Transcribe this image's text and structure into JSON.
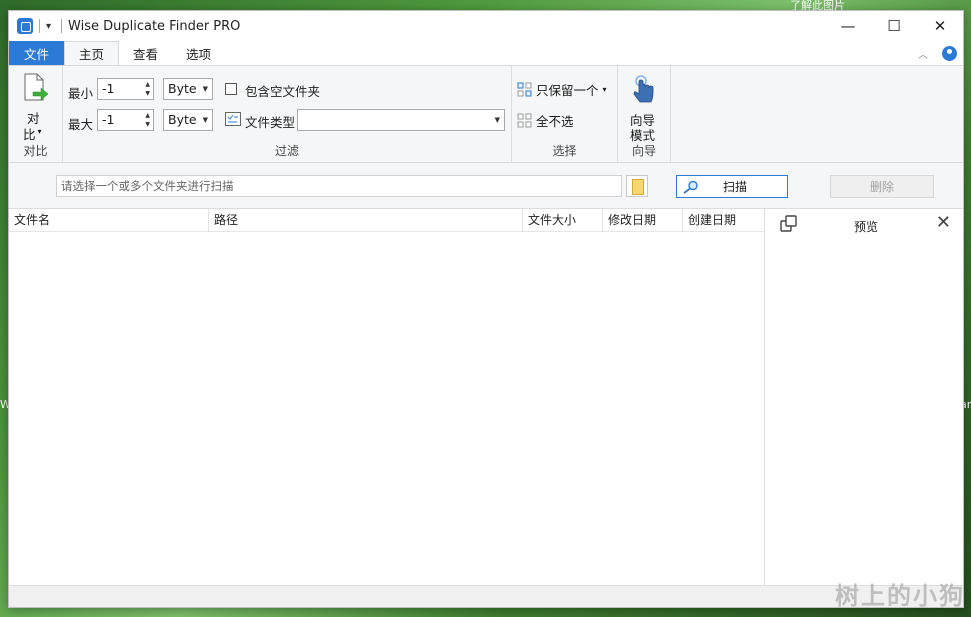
{
  "desktop": {
    "top_right_text": "了解此图片",
    "left_edge_text": "Wi",
    "right_edge_text": "ar"
  },
  "window": {
    "title": "Wise Duplicate Finder PRO",
    "controls": [
      "—",
      "☐",
      "✕"
    ]
  },
  "tabs": [
    {
      "label": "文件"
    },
    {
      "label": "主页"
    },
    {
      "label": "查看"
    },
    {
      "label": "选项"
    }
  ],
  "ribbon": {
    "compare": {
      "button_label_line1": "对",
      "button_label_line2": "比",
      "group_label": "对比"
    },
    "filter": {
      "min_label": "最小",
      "min_value": "-1",
      "min_unit": "Byte",
      "max_label": "最大",
      "max_value": "-1",
      "max_unit": "Byte",
      "include_empty_label": "包含空文件夹",
      "file_type_label": "文件类型",
      "file_type_value": "",
      "group_label": "过滤"
    },
    "select": {
      "keep_one_label": "只保留一个",
      "deselect_all_label": "全不选",
      "group_label": "选择"
    },
    "wizard": {
      "button_line1": "向导",
      "button_line2": "模式",
      "group_label": "向导"
    }
  },
  "scanbar": {
    "path_placeholder": "请选择一个或多个文件夹进行扫描",
    "scan_label": "扫描",
    "delete_label": "删除"
  },
  "table": {
    "columns": [
      "文件名",
      "路径",
      "文件大小",
      "修改日期",
      "创建日期"
    ]
  },
  "preview": {
    "title": "预览"
  },
  "watermark": "树上的小狗"
}
